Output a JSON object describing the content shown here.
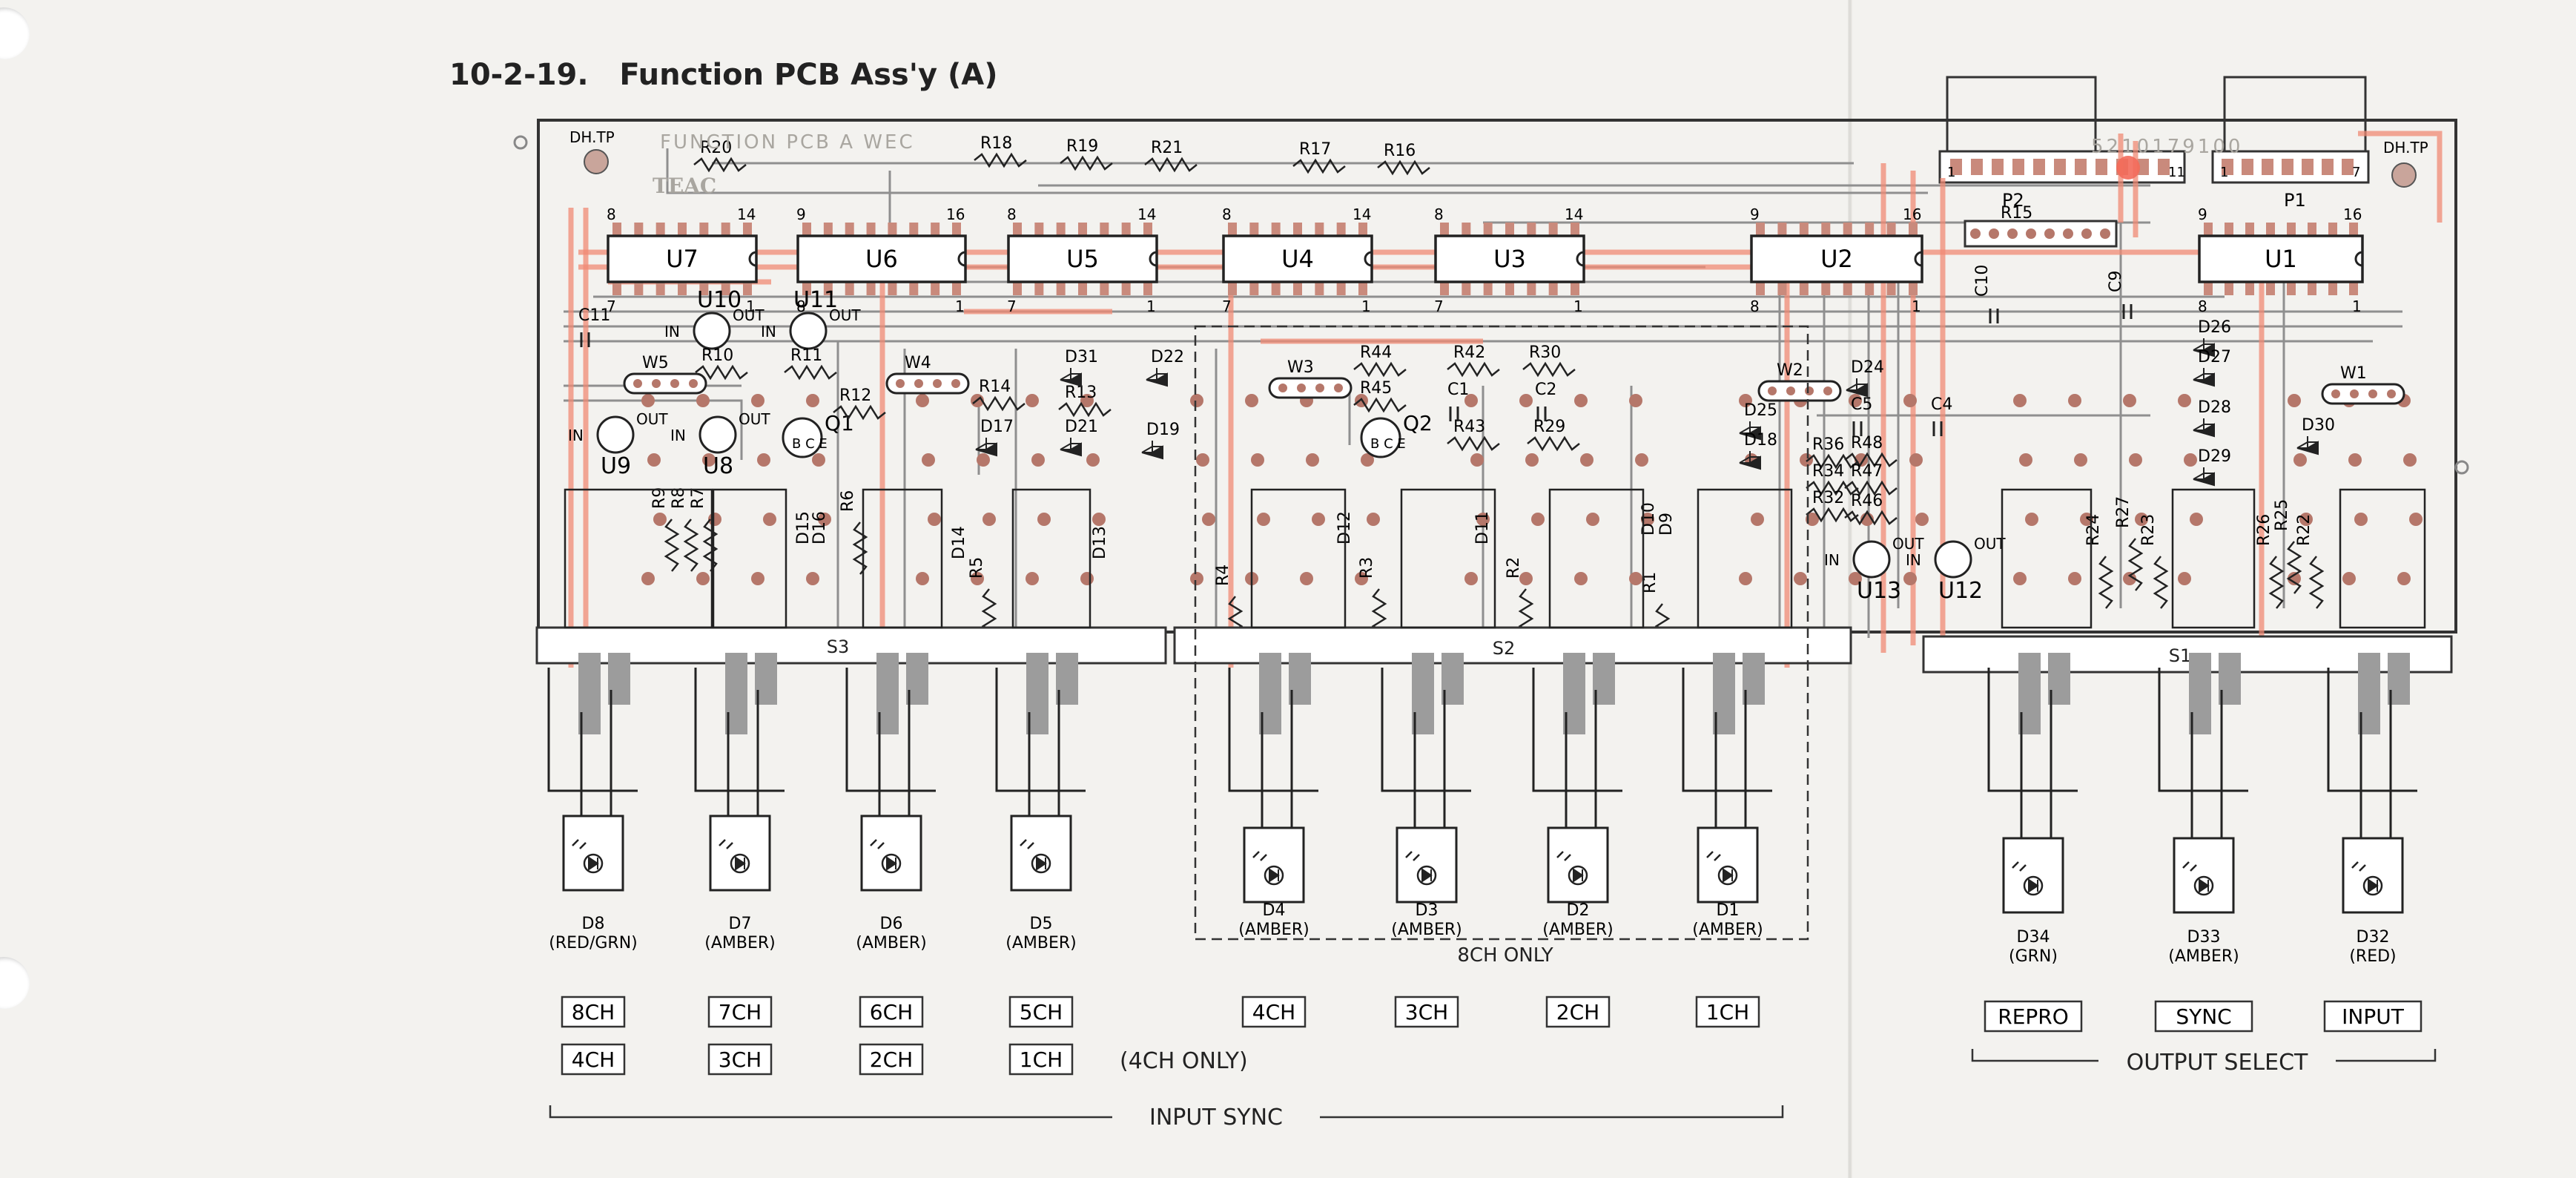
{
  "section_title": "10-2-19.   Function PCB Ass'y (A)",
  "pcb": {
    "silk_header": "FUNCTION PCB A     WEC",
    "brand": "TEAC",
    "part_number": "5210179100",
    "test_points": [
      "DH.TP",
      "DH.TP"
    ],
    "connectors": [
      {
        "name": "P2",
        "pins": [
          "1",
          "11"
        ]
      },
      {
        "name": "P1",
        "pins": [
          "1",
          "7"
        ]
      }
    ],
    "ics": [
      {
        "name": "U7",
        "pins": [
          "8",
          "14",
          "7",
          "1"
        ]
      },
      {
        "name": "U6",
        "pins": [
          "9",
          "16",
          "8",
          "1"
        ]
      },
      {
        "name": "U5",
        "pins": [
          "8",
          "14",
          "7",
          "1"
        ]
      },
      {
        "name": "U4",
        "pins": [
          "8",
          "14",
          "7",
          "1"
        ]
      },
      {
        "name": "U3",
        "pins": [
          "8",
          "14",
          "7",
          "1"
        ]
      },
      {
        "name": "U2",
        "pins": [
          "9",
          "16",
          "8",
          "1"
        ]
      },
      {
        "name": "U1",
        "pins": [
          "9",
          "16",
          "8",
          "1"
        ]
      }
    ],
    "regulators": [
      {
        "name": "U10",
        "in": "IN",
        "out": "OUT"
      },
      {
        "name": "U11",
        "in": "IN",
        "out": "OUT"
      },
      {
        "name": "U9",
        "in": "IN",
        "out": "OUT"
      },
      {
        "name": "U8",
        "in": "IN",
        "out": "OUT"
      },
      {
        "name": "U13",
        "in": "IN",
        "out": "OUT"
      },
      {
        "name": "U12",
        "in": "IN",
        "out": "OUT"
      }
    ],
    "transistors": [
      {
        "name": "Q1",
        "pins": "B  C  E"
      },
      {
        "name": "Q2",
        "pins": "B  C  E"
      }
    ],
    "jumpers": [
      "W5",
      "W4",
      "W3",
      "W2",
      "W1"
    ],
    "switches": [
      "S3",
      "S2",
      "S1"
    ],
    "resistors": [
      "R20",
      "R18",
      "R19",
      "R21",
      "R17",
      "R16",
      "R15",
      "R10",
      "R11",
      "R12",
      "R14",
      "R13",
      "R44",
      "R45",
      "R42",
      "R43",
      "R30",
      "R29",
      "R36",
      "R34",
      "R32",
      "R48",
      "R47",
      "R46",
      "R9",
      "R8",
      "R7",
      "R6",
      "R5",
      "R4",
      "R3",
      "R2",
      "R1",
      "R24",
      "R27",
      "R23",
      "R26",
      "R25",
      "R22"
    ],
    "capacitors": [
      "C11",
      "C10",
      "C9",
      "C1",
      "C2",
      "C5",
      "C4"
    ],
    "diodes": [
      "D31",
      "D22",
      "D17",
      "D21",
      "D19",
      "D24",
      "D25",
      "D18",
      "D26",
      "D27",
      "D28",
      "D29",
      "D30",
      "D15",
      "D16",
      "D14",
      "D13",
      "D12",
      "D11",
      "D10",
      "D9"
    ]
  },
  "leds": [
    {
      "name": "D8",
      "color": "(RED/GRN)",
      "label_top": "8CH",
      "label_bottom": "4CH"
    },
    {
      "name": "D7",
      "color": "(AMBER)",
      "label_top": "7CH",
      "label_bottom": "3CH"
    },
    {
      "name": "D6",
      "color": "(AMBER)",
      "label_top": "6CH",
      "label_bottom": "2CH"
    },
    {
      "name": "D5",
      "color": "(AMBER)",
      "label_top": "5CH",
      "label_bottom": "1CH"
    },
    {
      "name": "D4",
      "color": "(AMBER)",
      "label_top": "4CH"
    },
    {
      "name": "D3",
      "color": "(AMBER)",
      "label_top": "3CH"
    },
    {
      "name": "D2",
      "color": "(AMBER)",
      "label_top": "2CH"
    },
    {
      "name": "D1",
      "color": "(AMBER)",
      "label_top": "1CH"
    },
    {
      "name": "D34",
      "color": "(GRN)",
      "label_top": "REPRO"
    },
    {
      "name": "D33",
      "color": "(AMBER)",
      "label_top": "SYNC"
    },
    {
      "name": "D32",
      "color": "(RED)",
      "label_top": "INPUT"
    }
  ],
  "notes": {
    "four_ch_only": "(4CH ONLY)",
    "eight_ch_only": "8CH ONLY"
  },
  "groups": {
    "input_sync": "INPUT SYNC",
    "output_select": "OUTPUT SELECT"
  },
  "colors": {
    "paper": "#f3f2ef",
    "trace_gray": "#8f8f8f",
    "trace_copper": "#f08a74",
    "pad": "#b5776a"
  }
}
